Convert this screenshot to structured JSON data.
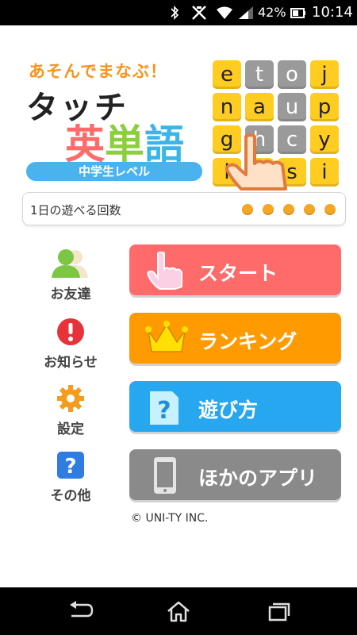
{
  "status_bar": {
    "battery_text": "42%",
    "clock": "10:14",
    "icons": [
      "bluetooth-icon",
      "nfc-icon",
      "wifi-icon",
      "signal-icon",
      "battery-icon"
    ]
  },
  "header": {
    "catchphrase": "あそんでまなぶ！",
    "title_line1": "タッチ",
    "title_line2_part1": "英",
    "title_line2_part2": "単",
    "title_line2_part3": "語",
    "level": "中学生レベル",
    "colors": {
      "orange": "#f7941d",
      "red": "#ff6a6a",
      "green": "#8ccf3d",
      "blue": "#3bb5e8"
    }
  },
  "letter_grid": {
    "rows": [
      [
        {
          "c": "e",
          "s": "y"
        },
        {
          "c": "t",
          "s": "g"
        },
        {
          "c": "o",
          "s": "g"
        },
        {
          "c": "j",
          "s": "y"
        }
      ],
      [
        {
          "c": "n",
          "s": "y"
        },
        {
          "c": "a",
          "s": "y"
        },
        {
          "c": "u",
          "s": "g"
        },
        {
          "c": "p",
          "s": "y"
        }
      ],
      [
        {
          "c": "g",
          "s": "y"
        },
        {
          "c": "h",
          "s": "g"
        },
        {
          "c": "c",
          "s": "g"
        },
        {
          "c": "y",
          "s": "y"
        }
      ],
      [
        {
          "c": "l",
          "s": "y"
        },
        {
          "c": "",
          "s": "y"
        },
        {
          "c": "s",
          "s": "y"
        },
        {
          "c": "i",
          "s": "y"
        }
      ]
    ]
  },
  "play_count": {
    "label": "1日の遊べる回数",
    "dots_remaining": 5
  },
  "side_menu": [
    {
      "label": "お友達",
      "icon": "friends-icon"
    },
    {
      "label": "お知らせ",
      "icon": "notice-icon"
    },
    {
      "label": "設定",
      "icon": "gear-icon"
    },
    {
      "label": "その他",
      "icon": "question-icon"
    }
  ],
  "buttons": {
    "start": "スタート",
    "ranking": "ランキング",
    "howto": "遊び方",
    "other_apps": "ほかのアプリ"
  },
  "footer": {
    "copyright": "© UNI-TY INC."
  },
  "nav_bar": {
    "icons": [
      "back-icon",
      "home-icon",
      "recent-apps-icon"
    ]
  }
}
